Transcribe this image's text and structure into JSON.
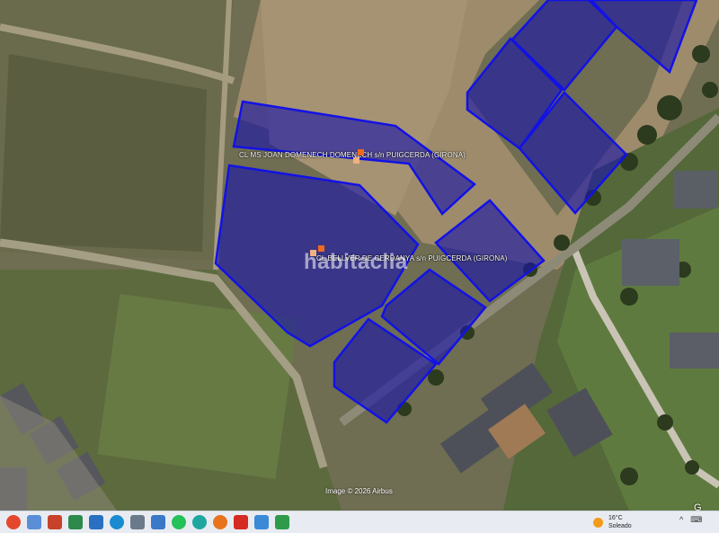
{
  "map": {
    "labels": {
      "parcel_a": "CL MS JOAN DOMENECH DOMENECH  s/n PUIGCERDA (GIRONA)",
      "parcel_b": "CL BELLVER DE CERDANYA  s/n PUIGCERDA (GIRONA)"
    },
    "watermark": "habitaclia",
    "attribution": "Image © 2026 Airbus",
    "corner_text": "G",
    "colors": {
      "parcel_fill": "#1914aa",
      "parcel_stroke": "#1212e6",
      "marker": "#f06a1e"
    }
  },
  "taskbar": {
    "icons": [
      "chrome-icon",
      "desktop-icon",
      "presentation-icon",
      "calculator-icon",
      "photos-icon",
      "edge-icon",
      "camera-icon",
      "downloads-icon",
      "whatsapp-icon",
      "connect-icon",
      "firefox-icon",
      "acrobat-icon",
      "store-icon",
      "sheet-icon"
    ],
    "weather": {
      "temp": "16°C",
      "condition": "Soleado"
    },
    "tray": [
      "^",
      "⌨"
    ]
  }
}
